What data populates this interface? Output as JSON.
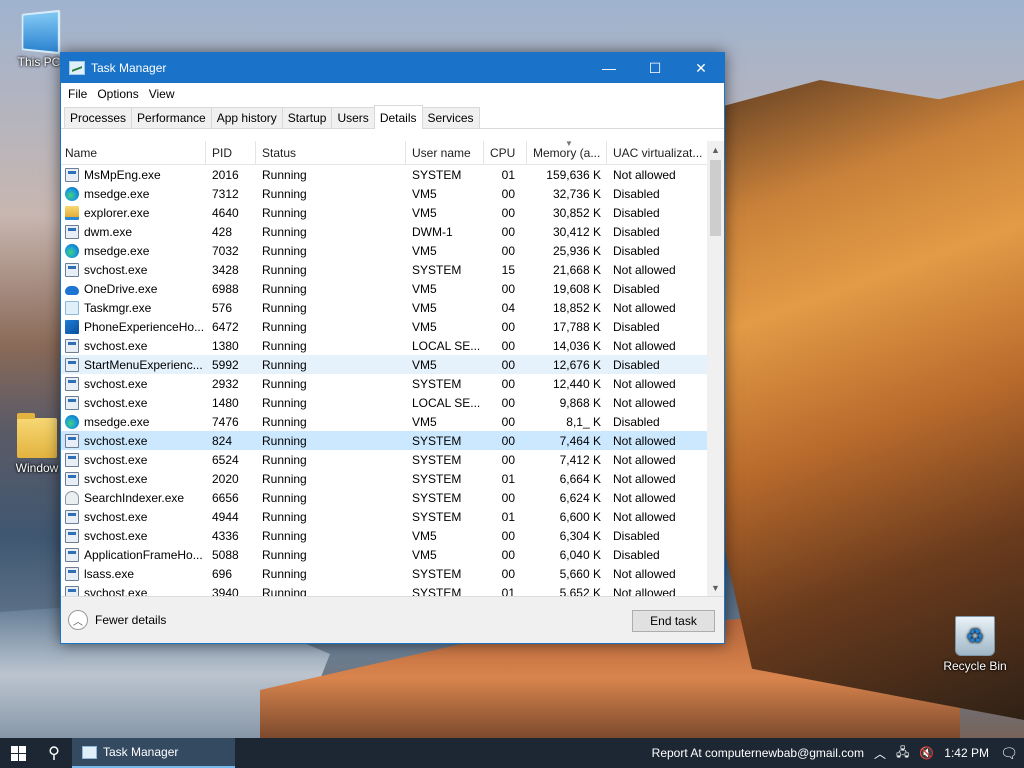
{
  "desktop": {
    "icons": [
      {
        "label": "This PC"
      },
      {
        "label": "Window"
      },
      {
        "label": "Recycle Bin"
      }
    ]
  },
  "window": {
    "title": "Task Manager",
    "menu": [
      "File",
      "Options",
      "View"
    ],
    "tabs": [
      {
        "label": "Processes",
        "active": false
      },
      {
        "label": "Performance",
        "active": false
      },
      {
        "label": "App history",
        "active": false
      },
      {
        "label": "Startup",
        "active": false
      },
      {
        "label": "Users",
        "active": false
      },
      {
        "label": "Details",
        "active": true
      },
      {
        "label": "Services",
        "active": false
      }
    ],
    "columns": [
      "Name",
      "PID",
      "Status",
      "User name",
      "CPU",
      "Memory (a...",
      "UAC virtualizat..."
    ],
    "rows": [
      {
        "icon": "win",
        "name": "MsMpEng.exe",
        "pid": "2016",
        "status": "Running",
        "user": "SYSTEM",
        "cpu": "01",
        "mem": "159,636 K",
        "uac": "Not allowed"
      },
      {
        "icon": "edge",
        "name": "msedge.exe",
        "pid": "7312",
        "status": "Running",
        "user": "VM5",
        "cpu": "00",
        "mem": "32,736 K",
        "uac": "Disabled"
      },
      {
        "icon": "folder",
        "name": "explorer.exe",
        "pid": "4640",
        "status": "Running",
        "user": "VM5",
        "cpu": "00",
        "mem": "30,852 K",
        "uac": "Disabled"
      },
      {
        "icon": "win",
        "name": "dwm.exe",
        "pid": "428",
        "status": "Running",
        "user": "DWM-1",
        "cpu": "00",
        "mem": "30,412 K",
        "uac": "Disabled"
      },
      {
        "icon": "edge",
        "name": "msedge.exe",
        "pid": "7032",
        "status": "Running",
        "user": "VM5",
        "cpu": "00",
        "mem": "25,936 K",
        "uac": "Disabled"
      },
      {
        "icon": "win",
        "name": "svchost.exe",
        "pid": "3428",
        "status": "Running",
        "user": "SYSTEM",
        "cpu": "15",
        "mem": "21,668 K",
        "uac": "Not allowed"
      },
      {
        "icon": "cloud",
        "name": "OneDrive.exe",
        "pid": "6988",
        "status": "Running",
        "user": "VM5",
        "cpu": "00",
        "mem": "19,608 K",
        "uac": "Disabled"
      },
      {
        "icon": "tm",
        "name": "Taskmgr.exe",
        "pid": "576",
        "status": "Running",
        "user": "VM5",
        "cpu": "04",
        "mem": "18,852 K",
        "uac": "Not allowed"
      },
      {
        "icon": "phone",
        "name": "PhoneExperienceHo...",
        "pid": "6472",
        "status": "Running",
        "user": "VM5",
        "cpu": "00",
        "mem": "17,788 K",
        "uac": "Disabled"
      },
      {
        "icon": "win",
        "name": "svchost.exe",
        "pid": "1380",
        "status": "Running",
        "user": "LOCAL SE...",
        "cpu": "00",
        "mem": "14,036 K",
        "uac": "Not allowed"
      },
      {
        "icon": "win",
        "name": "StartMenuExperienc...",
        "pid": "5992",
        "status": "Running",
        "user": "VM5",
        "cpu": "00",
        "mem": "12,676 K",
        "uac": "Disabled",
        "highlight": "light"
      },
      {
        "icon": "win",
        "name": "svchost.exe",
        "pid": "2932",
        "status": "Running",
        "user": "SYSTEM",
        "cpu": "00",
        "mem": "12,440 K",
        "uac": "Not allowed"
      },
      {
        "icon": "win",
        "name": "svchost.exe",
        "pid": "1480",
        "status": "Running",
        "user": "LOCAL SE...",
        "cpu": "00",
        "mem": "9,868 K",
        "uac": "Not allowed"
      },
      {
        "icon": "edge",
        "name": "msedge.exe",
        "pid": "7476",
        "status": "Running",
        "user": "VM5",
        "cpu": "00",
        "mem": "8,1_ K",
        "uac": "Disabled"
      },
      {
        "icon": "win",
        "name": "svchost.exe",
        "pid": "824",
        "status": "Running",
        "user": "SYSTEM",
        "cpu": "00",
        "mem": "7,464 K",
        "uac": "Not allowed",
        "highlight": "selected"
      },
      {
        "icon": "win",
        "name": "svchost.exe",
        "pid": "6524",
        "status": "Running",
        "user": "SYSTEM",
        "cpu": "00",
        "mem": "7,412 K",
        "uac": "Not allowed"
      },
      {
        "icon": "win",
        "name": "svchost.exe",
        "pid": "2020",
        "status": "Running",
        "user": "SYSTEM",
        "cpu": "01",
        "mem": "6,664 K",
        "uac": "Not allowed"
      },
      {
        "icon": "search",
        "name": "SearchIndexer.exe",
        "pid": "6656",
        "status": "Running",
        "user": "SYSTEM",
        "cpu": "00",
        "mem": "6,624 K",
        "uac": "Not allowed"
      },
      {
        "icon": "win",
        "name": "svchost.exe",
        "pid": "4944",
        "status": "Running",
        "user": "SYSTEM",
        "cpu": "01",
        "mem": "6,600 K",
        "uac": "Not allowed"
      },
      {
        "icon": "win",
        "name": "svchost.exe",
        "pid": "4336",
        "status": "Running",
        "user": "VM5",
        "cpu": "00",
        "mem": "6,304 K",
        "uac": "Disabled"
      },
      {
        "icon": "win",
        "name": "ApplicationFrameHo...",
        "pid": "5088",
        "status": "Running",
        "user": "VM5",
        "cpu": "00",
        "mem": "6,040 K",
        "uac": "Disabled"
      },
      {
        "icon": "win",
        "name": "lsass.exe",
        "pid": "696",
        "status": "Running",
        "user": "SYSTEM",
        "cpu": "00",
        "mem": "5,660 K",
        "uac": "Not allowed"
      },
      {
        "icon": "win",
        "name": "svchost.exe",
        "pid": "3940",
        "status": "Running",
        "user": "SYSTEM",
        "cpu": "01",
        "mem": "5,652 K",
        "uac": "Not allowed"
      }
    ],
    "footer": {
      "fewer_details": "Fewer details",
      "end_task": "End task"
    }
  },
  "taskbar": {
    "app_label": "Task Manager",
    "tray_text": "Report At computernewbab@gmail.com",
    "clock": "1:42 PM"
  },
  "colors": {
    "titlebar": "#1a73c8",
    "selection": "#cce8ff",
    "taskbar": "#1c2733"
  }
}
